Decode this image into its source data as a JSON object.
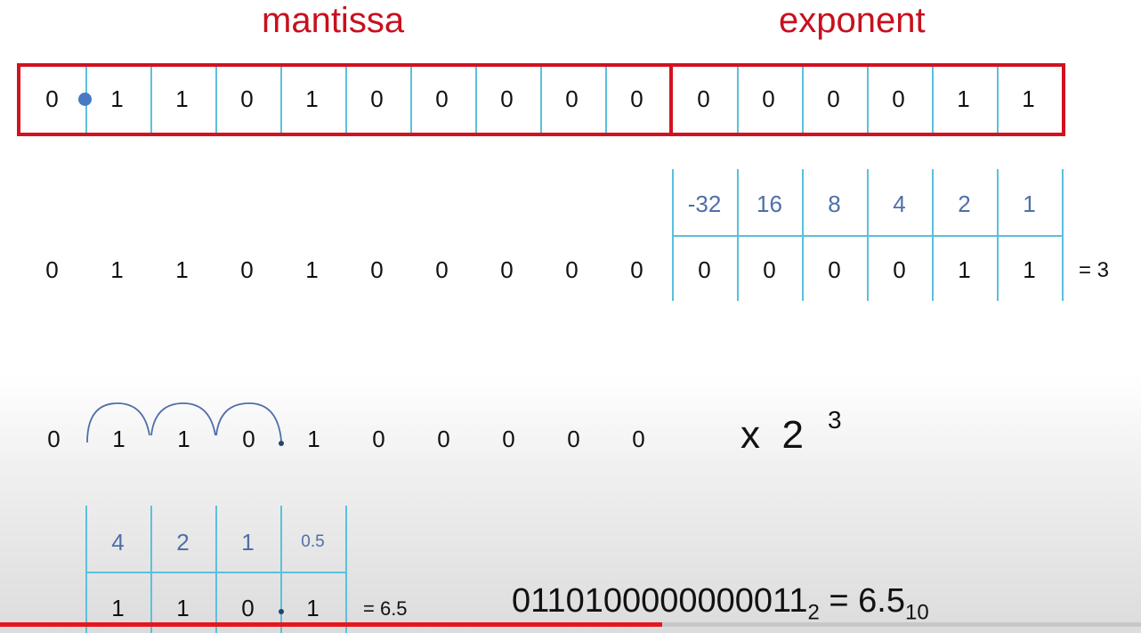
{
  "labels": {
    "mantissa": "mantissa",
    "exponent": "exponent"
  },
  "register": {
    "mantissa_bits": [
      "0",
      "1",
      "1",
      "0",
      "1",
      "0",
      "0",
      "0",
      "0",
      "0"
    ],
    "exponent_bits": [
      "0",
      "0",
      "0",
      "0",
      "1",
      "1"
    ]
  },
  "exponent_table": {
    "place_values": [
      "-32",
      "16",
      "8",
      "4",
      "2",
      "1"
    ],
    "bits": [
      "0",
      "0",
      "0",
      "0",
      "1",
      "1"
    ],
    "result": "= 3"
  },
  "row2_mantissa": [
    "0",
    "1",
    "1",
    "0",
    "1",
    "0",
    "0",
    "0",
    "0",
    "0"
  ],
  "row3": {
    "mantissa": [
      "0",
      "1",
      "1",
      "0",
      "1",
      "0",
      "0",
      "0",
      "0",
      "0"
    ],
    "multiplier": "x  2",
    "power": "3"
  },
  "bottom_table": {
    "place_values": [
      "4",
      "2",
      "1",
      "0.5"
    ],
    "bits": [
      "1",
      "1",
      "0",
      "1"
    ],
    "result": "= 6.5"
  },
  "final": {
    "binary": "0110100000000011",
    "base_bin": "2",
    "equals": "= 6.5",
    "base_dec": "10"
  },
  "colors": {
    "accent_red": "#d2121f",
    "grid_blue": "#5bc0de",
    "place_value_blue": "#4f6fa8"
  },
  "video_progress": 0.58
}
